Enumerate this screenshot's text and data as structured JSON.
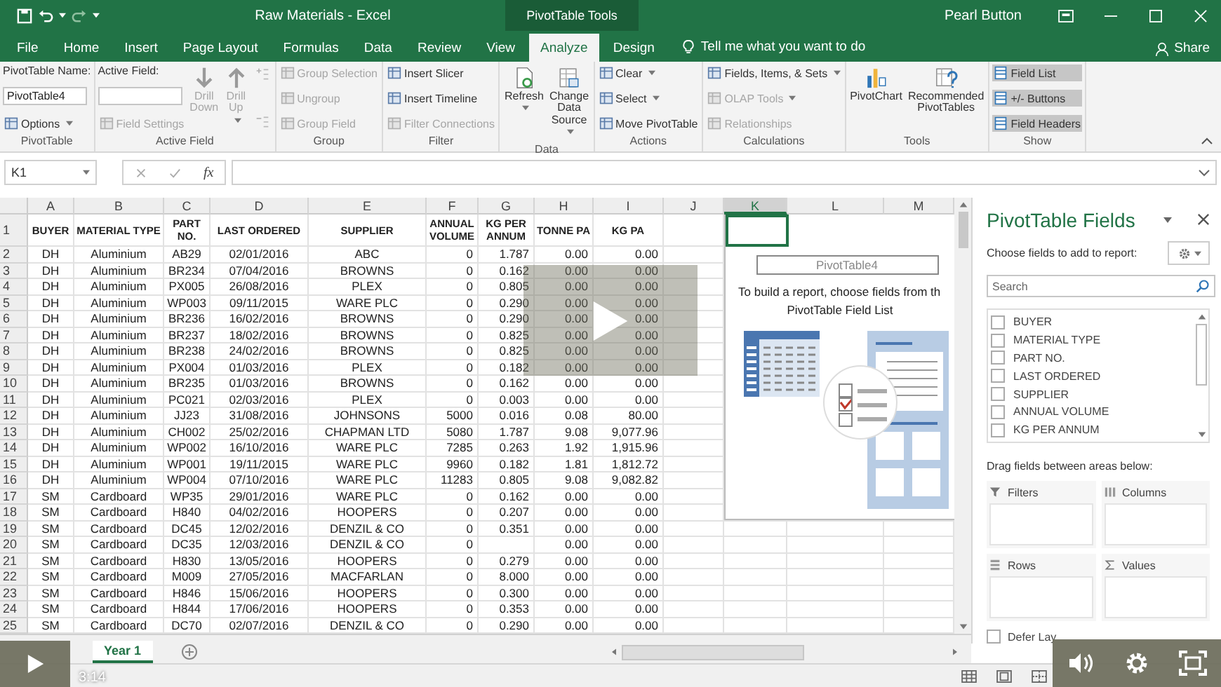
{
  "title_bar": {
    "title": "Raw Materials  -  Excel",
    "context": "PivotTable Tools",
    "user": "Pearl Button"
  },
  "tabs": [
    {
      "label": "File",
      "selected": false
    },
    {
      "label": "Home",
      "selected": false
    },
    {
      "label": "Insert",
      "selected": false
    },
    {
      "label": "Page Layout",
      "selected": false
    },
    {
      "label": "Formulas",
      "selected": false
    },
    {
      "label": "Data",
      "selected": false
    },
    {
      "label": "Review",
      "selected": false
    },
    {
      "label": "View",
      "selected": false
    },
    {
      "label": "Analyze",
      "selected": true
    },
    {
      "label": "Design",
      "selected": false
    }
  ],
  "tell_me": "Tell me what you want to do",
  "share": "Share",
  "ribbon": {
    "groups": [
      {
        "label": "PivotTable",
        "columns": [
          [
            {
              "kind": "label",
              "label": "PivotTable Name:"
            },
            {
              "kind": "field",
              "value": "PivotTable4"
            },
            {
              "kind": "small",
              "label": "Options",
              "disabled": false,
              "dropdown": true
            }
          ]
        ]
      },
      {
        "label": "Active Field",
        "columns": [
          [
            {
              "kind": "label",
              "label": "Active Field:"
            },
            {
              "kind": "field"
            },
            {
              "kind": "small",
              "label": "Field Settings",
              "disabled": true,
              "dropdown": false
            }
          ],
          [
            {
              "kind": "large",
              "label": "Drill Down",
              "disabled": true,
              "dropdown": false
            }
          ],
          [
            {
              "kind": "large",
              "label": "Drill Up",
              "disabled": true,
              "dropdown": true
            }
          ],
          [
            {
              "kind": "icon",
              "disabled": true,
              "dropdown": false
            },
            {
              "kind": "icon",
              "disabled": true,
              "dropdown": false
            }
          ]
        ]
      },
      {
        "label": "Group",
        "columns": [
          [
            {
              "kind": "small",
              "label": "Group Selection",
              "disabled": true,
              "dropdown": false
            },
            {
              "kind": "small",
              "label": "Ungroup",
              "disabled": true,
              "dropdown": false
            },
            {
              "kind": "small",
              "label": "Group Field",
              "disabled": true,
              "dropdown": false
            }
          ]
        ]
      },
      {
        "label": "Filter",
        "columns": [
          [
            {
              "kind": "small",
              "label": "Insert Slicer",
              "disabled": false,
              "dropdown": false
            },
            {
              "kind": "small",
              "label": "Insert Timeline",
              "disabled": false,
              "dropdown": false
            },
            {
              "kind": "small",
              "label": "Filter Connections",
              "disabled": true,
              "dropdown": false
            }
          ]
        ]
      },
      {
        "label": "Data",
        "columns": [
          [
            {
              "kind": "large",
              "label": "Refresh",
              "disabled": false,
              "dropdown": true
            }
          ],
          [
            {
              "kind": "large",
              "label": "Change Data Source",
              "disabled": false,
              "dropdown": true
            }
          ]
        ]
      },
      {
        "label": "Actions",
        "columns": [
          [
            {
              "kind": "small",
              "label": "Clear",
              "disabled": false,
              "dropdown": true
            },
            {
              "kind": "small",
              "label": "Select",
              "disabled": false,
              "dropdown": true
            },
            {
              "kind": "small",
              "label": "Move PivotTable",
              "disabled": false,
              "dropdown": false
            }
          ]
        ]
      },
      {
        "label": "Calculations",
        "columns": [
          [
            {
              "kind": "small",
              "label": "Fields, Items, & Sets",
              "disabled": false,
              "dropdown": true
            },
            {
              "kind": "small",
              "label": "OLAP Tools",
              "disabled": true,
              "dropdown": true
            },
            {
              "kind": "small",
              "label": "Relationships",
              "disabled": true,
              "dropdown": false
            }
          ]
        ]
      },
      {
        "label": "Tools",
        "columns": [
          [
            {
              "kind": "large",
              "label": "PivotChart",
              "disabled": false,
              "dropdown": false
            }
          ],
          [
            {
              "kind": "large",
              "label": "Recommended PivotTables",
              "disabled": false,
              "dropdown": false
            }
          ]
        ]
      },
      {
        "label": "Show",
        "columns": [
          [
            {
              "kind": "toggle",
              "label": "Field List",
              "on": true
            },
            {
              "kind": "toggle",
              "label": "+/- Buttons",
              "on": true
            },
            {
              "kind": "toggle",
              "label": "Field Headers",
              "on": true
            }
          ]
        ]
      }
    ]
  },
  "formula_bar": {
    "name_box": "K1",
    "function_label": "fx"
  },
  "sheet": {
    "columns": [
      {
        "label": "A",
        "selected": false
      },
      {
        "label": "B",
        "selected": false
      },
      {
        "label": "C",
        "selected": false
      },
      {
        "label": "D",
        "selected": false
      },
      {
        "label": "E",
        "selected": false
      },
      {
        "label": "F",
        "selected": false
      },
      {
        "label": "G",
        "selected": false
      },
      {
        "label": "H",
        "selected": false
      },
      {
        "label": "I",
        "selected": false
      },
      {
        "label": "J",
        "selected": false
      },
      {
        "label": "K",
        "selected": true
      },
      {
        "label": "L",
        "selected": false
      },
      {
        "label": "M",
        "selected": false
      }
    ],
    "header_row": {
      "number": "1",
      "cells": [
        "BUYER",
        "MATERIAL TYPE",
        "PART NO.",
        "LAST ORDERED",
        "SUPPLIER",
        "ANNUAL VOLUME",
        "KG PER ANNUM",
        "TONNE PA",
        "KG PA"
      ]
    },
    "rows": [
      {
        "number": "2",
        "cells": [
          "DH",
          "Aluminium",
          "AB29",
          "02/01/2016",
          "ABC",
          "0",
          "1.787",
          "0.00",
          "0.00"
        ]
      },
      {
        "number": "3",
        "cells": [
          "DH",
          "Aluminium",
          "BR234",
          "07/04/2016",
          "BROWNS",
          "0",
          "0.162",
          "0.00",
          "0.00"
        ]
      },
      {
        "number": "4",
        "cells": [
          "DH",
          "Aluminium",
          "PX005",
          "26/08/2016",
          "PLEX",
          "0",
          "0.805",
          "0.00",
          "0.00"
        ]
      },
      {
        "number": "5",
        "cells": [
          "DH",
          "Aluminium",
          "WP003",
          "09/11/2015",
          "WARE PLC",
          "0",
          "0.290",
          "0.00",
          "0.00"
        ]
      },
      {
        "number": "6",
        "cells": [
          "DH",
          "Aluminium",
          "BR236",
          "16/02/2016",
          "BROWNS",
          "0",
          "0.290",
          "0.00",
          "0.00"
        ]
      },
      {
        "number": "7",
        "cells": [
          "DH",
          "Aluminium",
          "BR237",
          "18/02/2016",
          "BROWNS",
          "0",
          "0.825",
          "0.00",
          "0.00"
        ]
      },
      {
        "number": "8",
        "cells": [
          "DH",
          "Aluminium",
          "BR238",
          "24/02/2016",
          "BROWNS",
          "0",
          "0.825",
          "0.00",
          "0.00"
        ]
      },
      {
        "number": "9",
        "cells": [
          "DH",
          "Aluminium",
          "PX004",
          "01/03/2016",
          "PLEX",
          "0",
          "0.182",
          "0.00",
          "0.00"
        ]
      },
      {
        "number": "10",
        "cells": [
          "DH",
          "Aluminium",
          "BR235",
          "01/03/2016",
          "BROWNS",
          "0",
          "0.162",
          "0.00",
          "0.00"
        ]
      },
      {
        "number": "11",
        "cells": [
          "DH",
          "Aluminium",
          "PC021",
          "02/03/2016",
          "PLEX",
          "0",
          "0.003",
          "0.00",
          "0.00"
        ]
      },
      {
        "number": "12",
        "cells": [
          "DH",
          "Aluminium",
          "JJ23",
          "31/08/2016",
          "JOHNSONS",
          "5000",
          "0.016",
          "0.08",
          "80.00"
        ]
      },
      {
        "number": "13",
        "cells": [
          "DH",
          "Aluminium",
          "CH002",
          "25/02/2016",
          "CHAPMAN LTD",
          "5080",
          "1.787",
          "9.08",
          "9,077.96"
        ]
      },
      {
        "number": "14",
        "cells": [
          "DH",
          "Aluminium",
          "WP002",
          "16/10/2016",
          "WARE PLC",
          "7285",
          "0.263",
          "1.92",
          "1,915.96"
        ]
      },
      {
        "number": "15",
        "cells": [
          "DH",
          "Aluminium",
          "WP001",
          "19/11/2015",
          "WARE PLC",
          "9960",
          "0.182",
          "1.81",
          "1,812.72"
        ]
      },
      {
        "number": "16",
        "cells": [
          "DH",
          "Aluminium",
          "WP004",
          "07/10/2016",
          "WARE PLC",
          "11283",
          "0.805",
          "9.08",
          "9,082.82"
        ]
      },
      {
        "number": "17",
        "cells": [
          "SM",
          "Cardboard",
          "WP35",
          "29/01/2016",
          "WARE PLC",
          "0",
          "0.162",
          "0.00",
          "0.00"
        ]
      },
      {
        "number": "18",
        "cells": [
          "SM",
          "Cardboard",
          "H840",
          "04/02/2016",
          "HOOPERS",
          "0",
          "0.207",
          "0.00",
          "0.00"
        ]
      },
      {
        "number": "19",
        "cells": [
          "SM",
          "Cardboard",
          "DC45",
          "12/02/2016",
          "DENZIL & CO",
          "0",
          "0.351",
          "0.00",
          "0.00"
        ]
      },
      {
        "number": "20",
        "cells": [
          "SM",
          "Cardboard",
          "DC35",
          "12/03/2016",
          "DENZIL & CO",
          "0",
          null,
          "0.00",
          "0.00"
        ]
      },
      {
        "number": "21",
        "cells": [
          "SM",
          "Cardboard",
          "H830",
          "13/05/2016",
          "HOOPERS",
          "0",
          "0.279",
          "0.00",
          "0.00"
        ]
      },
      {
        "number": "22",
        "cells": [
          "SM",
          "Cardboard",
          "M009",
          "27/05/2016",
          "MACFARLAN",
          "0",
          "8.000",
          "0.00",
          "0.00"
        ]
      },
      {
        "number": "23",
        "cells": [
          "SM",
          "Cardboard",
          "H846",
          "15/06/2016",
          "HOOPERS",
          "0",
          "0.300",
          "0.00",
          "0.00"
        ]
      },
      {
        "number": "24",
        "cells": [
          "SM",
          "Cardboard",
          "H844",
          "17/06/2016",
          "HOOPERS",
          "0",
          "0.353",
          "0.00",
          "0.00"
        ]
      },
      {
        "number": "25",
        "cells": [
          "SM",
          "Cardboard",
          "DC70",
          "02/07/2016",
          "DENZIL & CO",
          "0",
          "0.290",
          "0.00",
          "0.00"
        ]
      }
    ]
  },
  "pivot_placeholder": {
    "name": "PivotTable4",
    "lines": [
      "To build a report, choose fields from th",
      "PivotTable Field List"
    ]
  },
  "pivot_pane": {
    "title": "PivotTable Fields",
    "prompt": "Choose fields to add to report:",
    "search": {
      "placeholder": "Search"
    },
    "fields": [
      {
        "label": "BUYER",
        "checked": false
      },
      {
        "label": "MATERIAL TYPE",
        "checked": false
      },
      {
        "label": "PART NO.",
        "checked": false
      },
      {
        "label": "LAST ORDERED",
        "checked": false
      },
      {
        "label": "SUPPLIER",
        "checked": false
      },
      {
        "label": "ANNUAL VOLUME",
        "checked": false
      },
      {
        "label": "KG PER ANNUM",
        "checked": false
      }
    ],
    "areas_prompt": "Drag fields between areas below:",
    "areas": [
      {
        "label": "Filters",
        "kind": "filters"
      },
      {
        "label": "Columns",
        "kind": "columns"
      },
      {
        "label": "Rows",
        "kind": "rows"
      },
      {
        "label": "Values",
        "kind": "values"
      }
    ],
    "defer": {
      "label": "Defer Lay",
      "checked": false
    }
  },
  "sheet_tabs": [
    {
      "label": "Year 1",
      "selected": true
    }
  ],
  "video": {
    "time": "3:14"
  }
}
